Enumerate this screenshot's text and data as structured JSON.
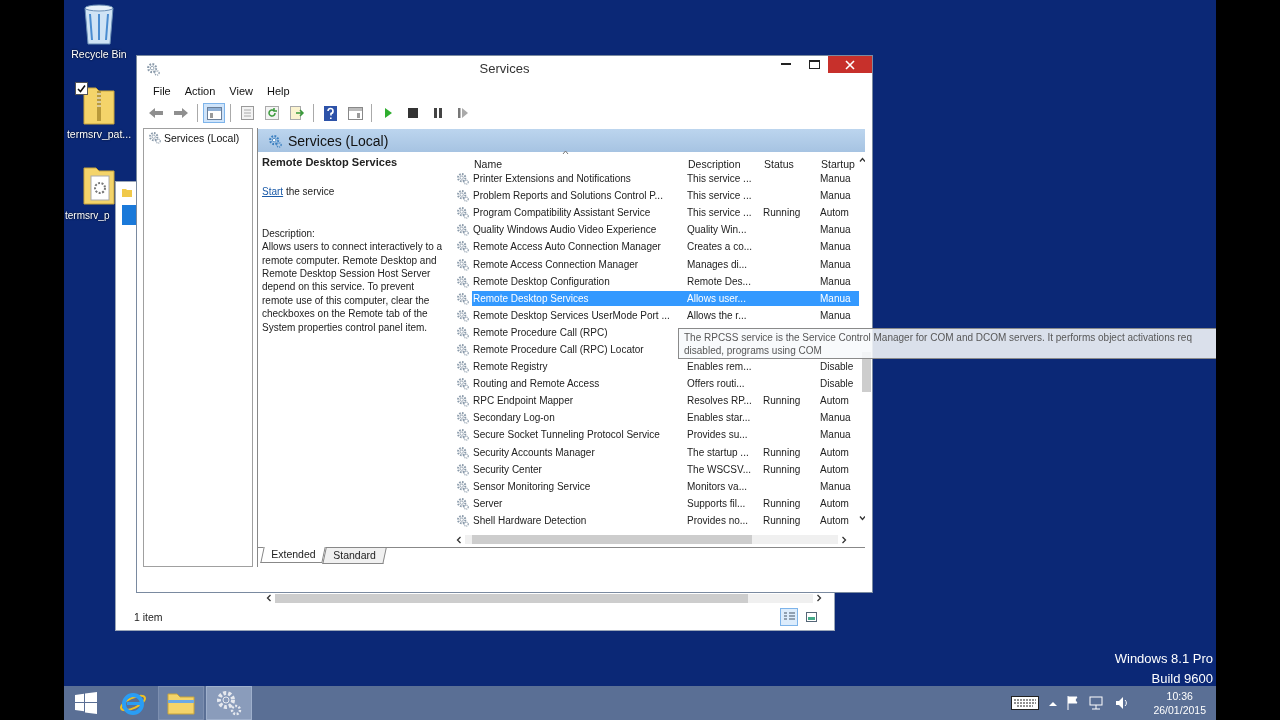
{
  "desktop": {
    "icons": [
      {
        "label": "Recycle Bin",
        "kind": "recycle",
        "checked": false
      },
      {
        "label": "termsrv_pat...",
        "kind": "zip",
        "checked": true
      },
      {
        "label": "termsrv_p",
        "kind": "folder",
        "checked": false
      }
    ],
    "edition": [
      "Windows 8.1 Pro",
      "Build 9600"
    ]
  },
  "explorer_window": {
    "status": "1 item"
  },
  "services_window": {
    "title": "Services",
    "menu": [
      "File",
      "Action",
      "View",
      "Help"
    ],
    "toolbar": [
      {
        "kind": "back",
        "pressed": false
      },
      {
        "kind": "forward",
        "pressed": false
      },
      {
        "kind": "separator"
      },
      {
        "kind": "tree",
        "pressed": true
      },
      {
        "kind": "separator"
      },
      {
        "kind": "properties",
        "pressed": false
      },
      {
        "kind": "refresh",
        "pressed": false
      },
      {
        "kind": "export",
        "pressed": false
      },
      {
        "kind": "separator"
      },
      {
        "kind": "help",
        "pressed": false
      },
      {
        "kind": "pane",
        "pressed": false
      },
      {
        "kind": "separator"
      },
      {
        "kind": "play",
        "pressed": false
      },
      {
        "kind": "stop",
        "pressed": false
      },
      {
        "kind": "pause",
        "pressed": false
      },
      {
        "kind": "resume",
        "pressed": false
      }
    ],
    "tree": [
      "Services (Local)"
    ],
    "pane_title": "Services (Local)",
    "detail": {
      "service_name": "Remote Desktop Services",
      "action_link": "Start",
      "action_text": "the service",
      "description_label": "Description:",
      "description": "Allows users to connect interactively to a remote computer. Remote Desktop and Remote Desktop Session Host Server depend on this service. To prevent remote use of this computer, clear the checkboxes on the Remote tab of the System properties control panel item."
    },
    "columns": [
      "Name",
      "Description",
      "Status",
      "Startup"
    ],
    "rows": [
      {
        "name": "Printer Extensions and Notifications",
        "description": "This service ...",
        "startup": "Manua",
        "selected": false
      },
      {
        "name": "Problem Reports and Solutions Control P...",
        "description": "This service ...",
        "startup": "Manua",
        "selected": false
      },
      {
        "name": "Program Compatibility Assistant Service",
        "description": "This service ...",
        "status": "Running",
        "startup": "Autom",
        "selected": false
      },
      {
        "name": "Quality Windows Audio Video Experience",
        "description": "Quality Win...",
        "startup": "Manua",
        "selected": false
      },
      {
        "name": "Remote Access Auto Connection Manager",
        "description": "Creates a co...",
        "startup": "Manua",
        "selected": false
      },
      {
        "name": "Remote Access Connection Manager",
        "description": "Manages di...",
        "startup": "Manua",
        "selected": false
      },
      {
        "name": "Remote Desktop Configuration",
        "description": "Remote Des...",
        "startup": "Manua",
        "selected": false
      },
      {
        "name": "Remote Desktop Services",
        "description": "Allows user...",
        "startup": "Manua",
        "selected": true
      },
      {
        "name": "Remote Desktop Services UserMode Port ...",
        "description": "Allows the r...",
        "startup": "Manua",
        "selected": false
      },
      {
        "name": "Remote Procedure Call (RPC)",
        "selected": false
      },
      {
        "name": "Remote Procedure Call (RPC) Locator",
        "selected": false
      },
      {
        "name": "Remote Registry",
        "description": "Enables rem...",
        "startup": "Disable",
        "selected": false
      },
      {
        "name": "Routing and Remote Access",
        "description": "Offers routi...",
        "startup": "Disable",
        "selected": false
      },
      {
        "name": "RPC Endpoint Mapper",
        "description": "Resolves RP...",
        "status": "Running",
        "startup": "Autom",
        "selected": false
      },
      {
        "name": "Secondary Log-on",
        "description": "Enables star...",
        "startup": "Manua",
        "selected": false
      },
      {
        "name": "Secure Socket Tunneling Protocol Service",
        "description": "Provides su...",
        "startup": "Manua",
        "selected": false
      },
      {
        "name": "Security Accounts Manager",
        "description": "The startup ...",
        "status": "Running",
        "startup": "Autom",
        "selected": false
      },
      {
        "name": "Security Center",
        "description": "The WSCSV...",
        "status": "Running",
        "startup": "Autom",
        "selected": false
      },
      {
        "name": "Sensor Monitoring Service",
        "description": "Monitors va...",
        "startup": "Manua",
        "selected": false
      },
      {
        "name": "Server",
        "description": "Supports fil...",
        "status": "Running",
        "startup": "Autom",
        "selected": false
      },
      {
        "name": "Shell Hardware Detection",
        "description": "Provides no...",
        "status": "Running",
        "startup": "Autom",
        "selected": false
      }
    ],
    "tabs": [
      {
        "label": "Extended",
        "selected": true
      },
      {
        "label": "Standard",
        "selected": false
      }
    ],
    "tooltip": [
      "The RPCSS service is the Service Control Manager for COM and DCOM servers. It performs object activations req",
      "disabled, programs using COM"
    ]
  },
  "taskbar": {
    "apps": [
      {
        "kind": "browser",
        "running": false,
        "selected": false
      },
      {
        "kind": "folder",
        "running": true,
        "selected": false
      },
      {
        "kind": "gear",
        "running": true,
        "selected": true
      }
    ],
    "clock": {
      "time": "10:36",
      "date": "26/01/2015"
    }
  }
}
